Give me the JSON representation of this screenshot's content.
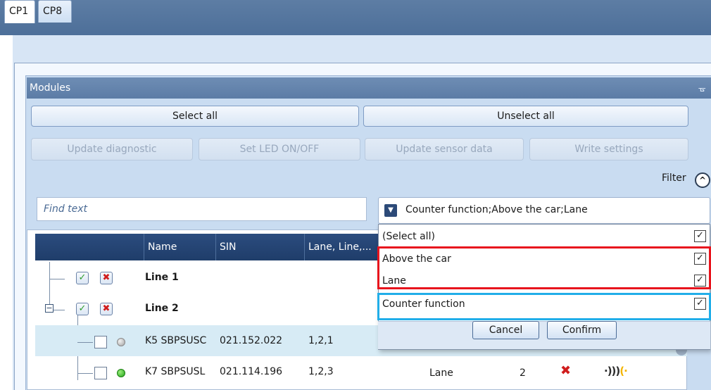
{
  "tabs": [
    {
      "label": "CP1",
      "active": true
    },
    {
      "label": "CP8",
      "active": false
    }
  ],
  "modules": {
    "title": "Modules",
    "pin_icon": "pin-icon",
    "buttons": {
      "select_all": "Select all",
      "unselect_all": "Unselect all",
      "update_diagnostic": "Update diagnostic",
      "set_led": "Set LED ON/OFF",
      "update_sensor": "Update sensor data",
      "write_settings": "Write settings"
    },
    "filter": {
      "label": "Filter",
      "toggle_icon": "collapse-up-icon",
      "find_placeholder": "Find text",
      "combo_value": "Counter function;Above the car;Lane"
    }
  },
  "grid": {
    "columns": [
      "Name",
      "SIN",
      "Lane, Line,..."
    ],
    "rows": [
      {
        "name": "Line 1"
      },
      {
        "name": "Line 2"
      },
      {
        "name": "K5 SBPSUSC",
        "sin": "021.152.022",
        "address": "1,2,1",
        "led": "gray"
      },
      {
        "name": "K7 SBPSUSL",
        "sin": "021.114.196",
        "address": "1,2,3",
        "led": "green",
        "function": "Lane",
        "count": "2"
      }
    ]
  },
  "dropdown": {
    "items": [
      {
        "label": "(Select all)",
        "checked": true
      },
      {
        "label": "Above the car",
        "checked": true
      },
      {
        "label": "Lane",
        "checked": true
      },
      {
        "label": "Counter function",
        "checked": true
      }
    ],
    "cancel": "Cancel",
    "confirm": "Confirm"
  },
  "colors": {
    "highlight_red": "#e8141d",
    "highlight_blue": "#21aee9",
    "header_blue": "#2b4c7e"
  }
}
